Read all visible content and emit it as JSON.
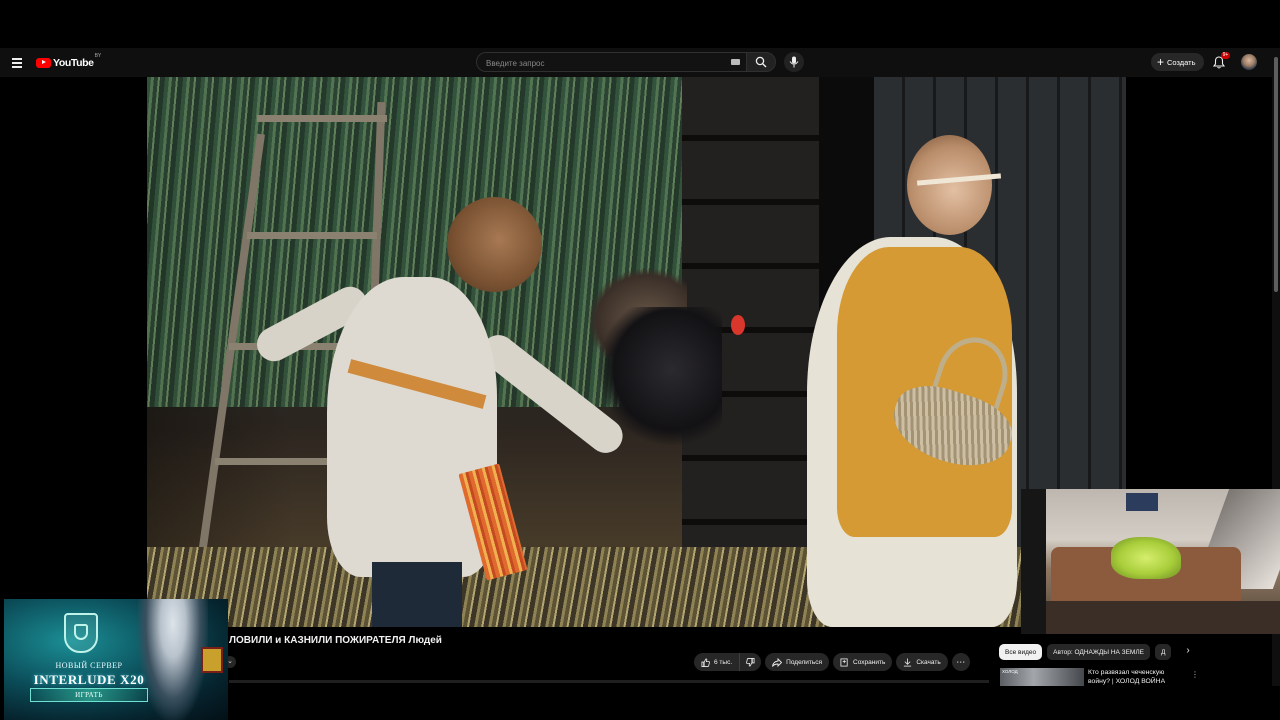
{
  "topbar": {
    "logo_text": "YouTube",
    "logo_region": "BY",
    "search_placeholder": "Введите запрос",
    "create_label": "Создать",
    "notifications_badge": "9+"
  },
  "video": {
    "title": "ЛОВИЛИ и КАЗНИЛИ ПОЖИРАТЕЛЯ Людей"
  },
  "actions": {
    "like_count": "6 тыс.",
    "share_label": "Поделиться",
    "save_label": "Сохранить",
    "download_label": "Скачать"
  },
  "sidebar": {
    "chips": [
      "Все видео",
      "Автор: ОДНАЖДЫ НА ЗЕМЛЕ",
      "Д"
    ],
    "recommendation": {
      "thumb_label": "ХОЛОД",
      "title": "Кто развязал чеченскую войну? | ХОЛОД ВОЙНА"
    }
  },
  "ad": {
    "line1": "НОВЫЙ СЕРВЕР",
    "line2": "INTERLUDE X20",
    "button": "ИГРАТЬ"
  },
  "colors": {
    "youtube_red": "#ff0000",
    "background": "#0f0f0f",
    "pill": "#272727"
  }
}
